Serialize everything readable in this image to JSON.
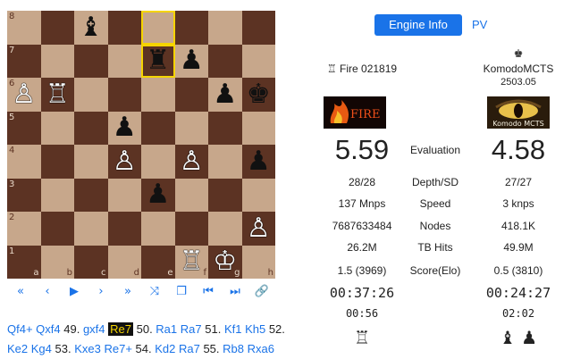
{
  "board": {
    "ranks": [
      "8",
      "7",
      "6",
      "5",
      "4",
      "3",
      "2",
      "1"
    ],
    "files": [
      "a",
      "b",
      "c",
      "d",
      "e",
      "f",
      "g",
      "h"
    ],
    "highlight": [
      "e8",
      "e7"
    ],
    "pieces": [
      {
        "sq": "c8",
        "glyph": "♝",
        "side": "b",
        "name": "black-bishop-c8"
      },
      {
        "sq": "e7",
        "glyph": "♜",
        "side": "b",
        "name": "black-rook-e7"
      },
      {
        "sq": "f7",
        "glyph": "♟",
        "side": "b",
        "name": "black-pawn-f7"
      },
      {
        "sq": "a6",
        "glyph": "♙",
        "side": "w",
        "name": "white-pawn-a6"
      },
      {
        "sq": "b6",
        "glyph": "♖",
        "side": "w",
        "name": "white-rook-b6"
      },
      {
        "sq": "g6",
        "glyph": "♟",
        "side": "b",
        "name": "black-pawn-g6"
      },
      {
        "sq": "h6",
        "glyph": "♚",
        "side": "b",
        "name": "black-king-h6"
      },
      {
        "sq": "d5",
        "glyph": "♟",
        "side": "b",
        "name": "black-pawn-d5"
      },
      {
        "sq": "d4",
        "glyph": "♙",
        "side": "w",
        "name": "white-pawn-d4"
      },
      {
        "sq": "f4",
        "glyph": "♙",
        "side": "w",
        "name": "white-pawn-f4"
      },
      {
        "sq": "h4",
        "glyph": "♟",
        "side": "b",
        "name": "black-pawn-h4"
      },
      {
        "sq": "e3",
        "glyph": "♟",
        "side": "b",
        "name": "black-pawn-e3"
      },
      {
        "sq": "h2",
        "glyph": "♙",
        "side": "w",
        "name": "white-pawn-h2"
      },
      {
        "sq": "f1",
        "glyph": "♖",
        "side": "w",
        "name": "white-rook-f1"
      },
      {
        "sq": "g1",
        "glyph": "♔",
        "side": "w",
        "name": "white-king-g1"
      }
    ]
  },
  "controls": [
    {
      "name": "first-move-icon",
      "glyph": "«"
    },
    {
      "name": "prev-move-icon",
      "glyph": "‹"
    },
    {
      "name": "play-icon",
      "glyph": "▶"
    },
    {
      "name": "next-move-icon",
      "glyph": "›"
    },
    {
      "name": "last-move-icon",
      "glyph": "»"
    },
    {
      "name": "flip-board-icon",
      "glyph": "⤨"
    },
    {
      "name": "copy-icon",
      "glyph": "❐"
    },
    {
      "name": "skip-start-icon",
      "glyph": "⏮"
    },
    {
      "name": "skip-end-icon",
      "glyph": "⏭"
    },
    {
      "name": "link-icon",
      "glyph": "🔗"
    }
  ],
  "moves": [
    {
      "t": "Qf4+",
      "k": "mv"
    },
    {
      "t": " ",
      "k": "sp"
    },
    {
      "t": "Qxf4",
      "k": "mv"
    },
    {
      "t": " 49. ",
      "k": "num"
    },
    {
      "t": "gxf4",
      "k": "mv"
    },
    {
      "t": " ",
      "k": "sp"
    },
    {
      "t": "Re7",
      "k": "cur"
    },
    {
      "t": " 50. ",
      "k": "num"
    },
    {
      "t": "Ra1",
      "k": "mv"
    },
    {
      "t": " ",
      "k": "sp"
    },
    {
      "t": "Ra7",
      "k": "mv"
    },
    {
      "t": " 51. ",
      "k": "num"
    },
    {
      "t": "Kf1",
      "k": "mv"
    },
    {
      "t": " ",
      "k": "sp"
    },
    {
      "t": "Kh5",
      "k": "mv"
    },
    {
      "t": " 52. ",
      "k": "num"
    },
    {
      "t": "Ke2",
      "k": "mv"
    },
    {
      "t": " ",
      "k": "sp"
    },
    {
      "t": "Kg4",
      "k": "mv"
    },
    {
      "t": " 53. ",
      "k": "num"
    },
    {
      "t": "Kxe3",
      "k": "mv"
    },
    {
      "t": " ",
      "k": "sp"
    },
    {
      "t": "Re7+",
      "k": "mv"
    },
    {
      "t": " 54. ",
      "k": "num"
    },
    {
      "t": "Kd2",
      "k": "mv"
    },
    {
      "t": " ",
      "k": "sp"
    },
    {
      "t": "Ra7",
      "k": "mv"
    },
    {
      "t": " 55. ",
      "k": "num"
    },
    {
      "t": "Rb8",
      "k": "mv"
    },
    {
      "t": " ",
      "k": "sp"
    },
    {
      "t": "Rxa6",
      "k": "mv"
    }
  ],
  "tabs": {
    "engine_info": "Engine Info",
    "pv": "PV"
  },
  "white": {
    "icon": "♖",
    "engine": "Fire 021819",
    "logo_text": "FIRE",
    "eval": "5.59",
    "depth": "28/28",
    "speed": "137 Mnps",
    "nodes": "7687633484",
    "tb_hits": "26.2M",
    "score_elo": "1.5 (3969)",
    "clock": "00:37:26",
    "move_time": "00:56",
    "captured": "♖"
  },
  "black": {
    "icon": "♚",
    "engine": "KomodoMCTS",
    "version": "2503.05",
    "logo_text": "Komodo MCTS",
    "eval": "4.58",
    "depth": "27/27",
    "speed": "3 knps",
    "nodes": "418.1K",
    "tb_hits": "49.9M",
    "score_elo": "0.5 (3810)",
    "clock": "00:24:27",
    "move_time": "02:02",
    "captured": "♝ ♟"
  },
  "labels": {
    "evaluation": "Evaluation",
    "depth": "Depth/SD",
    "speed": "Speed",
    "nodes": "Nodes",
    "tb_hits": "TB Hits",
    "score": "Score(Elo)"
  },
  "colors": {
    "light_square": "#c7a78b",
    "dark_square": "#5c3323",
    "highlight": "#f5d400",
    "accent": "#1a73e8"
  }
}
